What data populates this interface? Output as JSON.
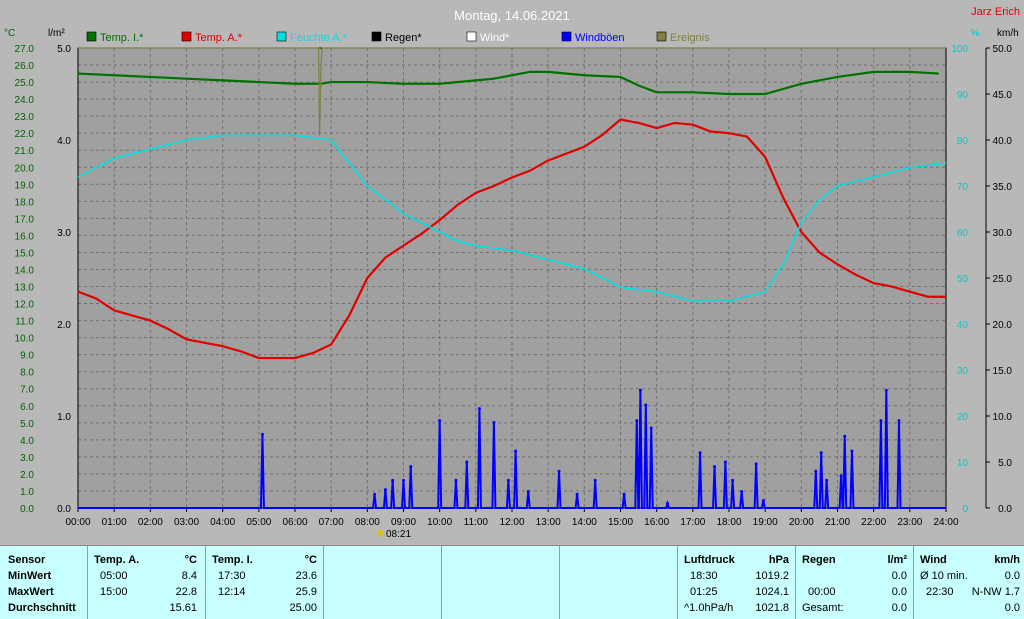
{
  "chart_data": {
    "type": "line",
    "title": "Montag, 14.06.2021",
    "author": "Jarz Erich",
    "x_ticks": [
      "00:00",
      "01:00",
      "02:00",
      "03:00",
      "04:00",
      "05:00",
      "06:00",
      "07:00",
      "08:00",
      "09:00",
      "10:00",
      "11:00",
      "12:00",
      "13:00",
      "14:00",
      "15:00",
      "16:00",
      "17:00",
      "18:00",
      "19:00",
      "20:00",
      "21:00",
      "22:00",
      "23:00",
      "24:00"
    ],
    "x_range": [
      0,
      24
    ],
    "axes": {
      "temp": {
        "unit": "°C",
        "min": 0,
        "max": 27,
        "step": 1,
        "color": "#006400"
      },
      "rain": {
        "unit": "l/m²",
        "min": 0,
        "max": 5,
        "ticks": [
          0,
          1,
          2,
          3,
          4,
          5
        ],
        "color": "#000000"
      },
      "humidity": {
        "unit": "%",
        "min": 0,
        "max": 100,
        "ticks": [
          0,
          10,
          20,
          30,
          40,
          50,
          60,
          70,
          80,
          90,
          100
        ],
        "color": "#00c8c8"
      },
      "wind": {
        "unit": "km/h",
        "min": 0,
        "max": 50,
        "ticks": [
          0,
          5,
          10,
          15,
          20,
          25,
          30,
          35,
          40,
          45,
          50
        ],
        "color": "#000000"
      }
    },
    "legend": [
      {
        "name": "Temp. I.*",
        "color": "#007000"
      },
      {
        "name": "Temp. A.*",
        "color": "#e00000"
      },
      {
        "name": "Feuchte A.*",
        "color": "#00e0e0"
      },
      {
        "name": "Regen*",
        "color": "#000000"
      },
      {
        "name": "Wind*",
        "color": "#ffffff"
      },
      {
        "name": "Windböen",
        "color": "#0000ff"
      },
      {
        "name": "Ereignis",
        "color": "#808040"
      }
    ],
    "event": {
      "time": "08:21",
      "x": 8.35
    },
    "series": [
      {
        "name": "Temp. I.*",
        "axis": "temp",
        "color": "#007000",
        "x": [
          0,
          1,
          2,
          3,
          4,
          5,
          6,
          6.7,
          7,
          8,
          9,
          10,
          11,
          11.5,
          12,
          12.5,
          13,
          14,
          15,
          15.5,
          16,
          17,
          18,
          19,
          20,
          21,
          22,
          23,
          23.8
        ],
        "y": [
          25.5,
          25.4,
          25.3,
          25.2,
          25.1,
          25.0,
          24.9,
          24.9,
          25.0,
          25.0,
          24.9,
          24.9,
          25.1,
          25.2,
          25.4,
          25.6,
          25.6,
          25.4,
          25.3,
          24.8,
          24.4,
          24.4,
          24.3,
          24.3,
          24.9,
          25.3,
          25.6,
          25.6,
          25.5
        ]
      },
      {
        "name": "Temp. A.*",
        "axis": "temp",
        "color": "#e00000",
        "x": [
          0,
          0.5,
          1,
          2,
          2.5,
          3,
          4,
          4.5,
          5,
          6,
          6.5,
          7,
          7.5,
          8,
          8.5,
          9,
          9.5,
          10,
          10.5,
          11,
          11.5,
          12,
          12.5,
          13,
          13.5,
          14,
          14.5,
          15,
          15.5,
          16,
          16.5,
          17,
          17.5,
          18,
          18.5,
          19,
          19.5,
          20,
          20.5,
          21,
          21.5,
          22,
          22.5,
          23,
          23.5,
          24
        ],
        "y": [
          12.7,
          12.3,
          11.6,
          11.0,
          10.5,
          9.9,
          9.5,
          9.2,
          8.8,
          8.8,
          9.1,
          9.6,
          11.3,
          13.5,
          14.7,
          15.4,
          16.1,
          16.9,
          17.8,
          18.5,
          18.9,
          19.4,
          19.8,
          20.4,
          20.8,
          21.2,
          21.9,
          22.8,
          22.6,
          22.3,
          22.6,
          22.5,
          22.1,
          22.0,
          21.8,
          20.6,
          18.2,
          16.2,
          15.0,
          14.3,
          13.7,
          13.2,
          13.0,
          12.7,
          12.4,
          12.4
        ]
      },
      {
        "name": "Feuchte A.*",
        "axis": "humidity",
        "color": "#00e0e0",
        "x": [
          0,
          1,
          2,
          3,
          4,
          5,
          6,
          7,
          7.5,
          8,
          8.5,
          9,
          9.5,
          10,
          10.5,
          11,
          12,
          13,
          14,
          15,
          16,
          17,
          18,
          19,
          19.5,
          20,
          20.5,
          21,
          22,
          23,
          24
        ],
        "y": [
          72,
          76,
          78,
          80,
          81,
          81,
          81,
          80,
          75,
          70,
          67,
          64,
          62,
          60,
          58,
          57,
          56,
          54,
          52,
          48,
          47,
          45,
          45,
          47,
          53,
          62,
          67,
          70,
          72,
          74,
          75
        ]
      },
      {
        "name": "Ereignis",
        "axis": "humidity",
        "color": "#808040",
        "x": [
          0,
          6.65,
          6.68,
          6.72,
          6.75,
          7,
          8,
          9,
          10,
          11,
          12,
          13,
          14,
          15,
          16,
          17,
          18,
          19,
          20,
          21,
          22,
          23,
          24
        ],
        "y": [
          100,
          100,
          81,
          96,
          100,
          100,
          100,
          100,
          100,
          100,
          100,
          100,
          100,
          100,
          100,
          100,
          100,
          100,
          100,
          100,
          100,
          100,
          100
        ]
      },
      {
        "name": "Windböen",
        "axis": "wind",
        "color": "#0000ff",
        "spikes": [
          [
            5.1,
            8
          ],
          [
            8.2,
            1.5
          ],
          [
            8.5,
            2
          ],
          [
            8.7,
            3
          ],
          [
            9.0,
            3
          ],
          [
            9.2,
            4.5
          ],
          [
            10.0,
            9.5
          ],
          [
            10.45,
            3
          ],
          [
            10.75,
            5
          ],
          [
            11.1,
            10.8
          ],
          [
            11.5,
            9.3
          ],
          [
            11.9,
            3
          ],
          [
            12.1,
            6.2
          ],
          [
            12.45,
            1.8
          ],
          [
            13.3,
            4
          ],
          [
            13.8,
            1.5
          ],
          [
            14.3,
            3
          ],
          [
            15.1,
            1.5
          ],
          [
            15.45,
            9.5
          ],
          [
            15.55,
            12.8
          ],
          [
            15.7,
            11.2
          ],
          [
            15.85,
            8.7
          ],
          [
            16.3,
            0.5
          ],
          [
            17.2,
            6
          ],
          [
            17.6,
            4.5
          ],
          [
            17.9,
            5
          ],
          [
            18.1,
            3
          ],
          [
            18.35,
            1.8
          ],
          [
            18.75,
            4.8
          ],
          [
            18.95,
            0.8
          ],
          [
            20.4,
            4
          ],
          [
            20.55,
            6
          ],
          [
            20.7,
            3
          ],
          [
            21.1,
            3.5
          ],
          [
            21.2,
            7.8
          ],
          [
            21.4,
            6.2
          ],
          [
            22.2,
            9.5
          ],
          [
            22.35,
            12.8
          ],
          [
            22.7,
            9.5
          ]
        ]
      }
    ]
  },
  "table": {
    "sensor": {
      "header": "Sensor",
      "rows": [
        "MinWert",
        "MaxWert",
        "Durchschnitt"
      ]
    },
    "temp_a": {
      "header": "Temp. A.",
      "unit": "°C",
      "min_time": "05:00",
      "min_val": "8.4",
      "max_time": "15:00",
      "max_val": "22.8",
      "avg": "15.61"
    },
    "temp_i": {
      "header": "Temp. I.",
      "unit": "°C",
      "min_time": "17:30",
      "min_val": "23.6",
      "max_time": "12:14",
      "max_val": "25.9",
      "avg": "25.00"
    },
    "pressure": {
      "header": "Luftdruck",
      "unit": "hPa",
      "min_time": "18:30",
      "min_val": "1019.2",
      "max_time": "01:25",
      "max_val": "1024.1",
      "trend_label": "^1.0hPa/h",
      "trend_val": "1021.8"
    },
    "rain": {
      "header": "Regen",
      "unit": "l/m²",
      "r1_label": "",
      "r1_val": "0.0",
      "r2_label": "00:00",
      "r2_val": "0.0",
      "r3_label": "Gesamt:",
      "r3_val": "0.0"
    },
    "wind": {
      "header": "Wind",
      "unit": "km/h",
      "r1_label": "Ø 10 min.",
      "r1_val": "0.0",
      "r2_label": "22:30",
      "r2_val": "N-NW 1.7",
      "r3_label": "",
      "r3_val": "0.0"
    }
  }
}
